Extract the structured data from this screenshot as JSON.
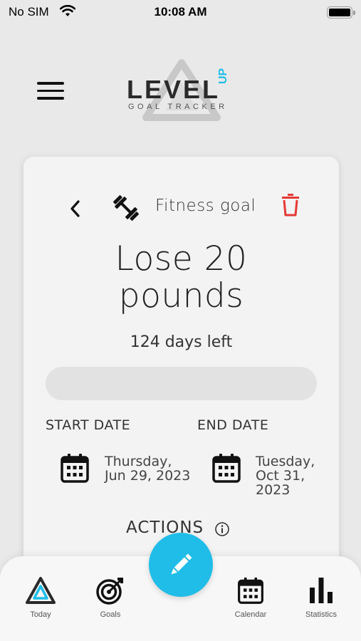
{
  "status_bar": {
    "carrier": "No SIM",
    "time": "10:08 AM"
  },
  "header": {
    "logo_text": "LEVEL UP",
    "logo_subtitle": "GOAL TRACKER"
  },
  "goal": {
    "category": "Fitness goal",
    "category_icon": "dumbbell-icon",
    "title": "Lose 20 pounds",
    "days_left": "124 days left",
    "progress_fraction": 0,
    "start_label": "START DATE",
    "start_day": "Thursday,",
    "start_date": "Jun 29, 2023",
    "end_label": "END DATE",
    "end_day": "Tuesday,",
    "end_date": "Oct 31, 2023",
    "actions_label": "ACTIONS"
  },
  "tabbar": {
    "items": [
      {
        "label": "Today",
        "icon": "today-logo-icon"
      },
      {
        "label": "Goals",
        "icon": "target-icon"
      },
      {
        "label": "Calendar",
        "icon": "calendar-icon"
      },
      {
        "label": "Statistics",
        "icon": "bar-chart-icon"
      }
    ],
    "fab_icon": "pencil-icon"
  },
  "colors": {
    "accent": "#1fbde8",
    "delete": "#e53935",
    "background": "#e9e9e9",
    "card": "#f3f3f3"
  }
}
